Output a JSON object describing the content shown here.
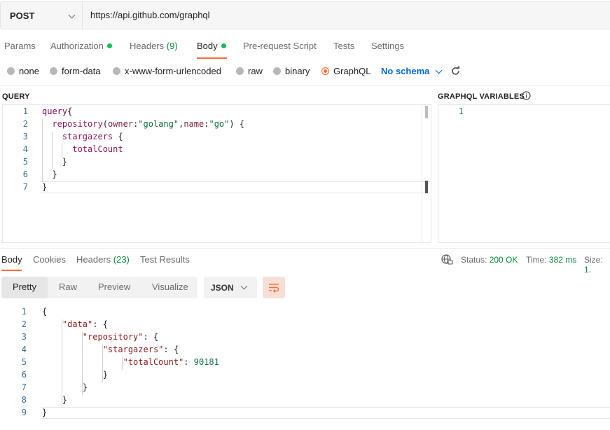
{
  "request": {
    "method": "POST",
    "url": "https://api.github.com/graphql"
  },
  "tabs": [
    {
      "label": "Params"
    },
    {
      "label": "Authorization"
    },
    {
      "label": "Headers",
      "count": "(9)"
    },
    {
      "label": "Body"
    },
    {
      "label": "Pre-request Script"
    },
    {
      "label": "Tests"
    },
    {
      "label": "Settings"
    }
  ],
  "body_modes": [
    {
      "label": "none"
    },
    {
      "label": "form-data"
    },
    {
      "label": "x-www-form-urlencoded"
    },
    {
      "label": "raw"
    },
    {
      "label": "binary"
    },
    {
      "label": "GraphQL",
      "selected": true
    }
  ],
  "schema": {
    "label": "No schema"
  },
  "query_title": "QUERY",
  "variables_title": "GRAPHQL VARIABLES",
  "query_lines": [
    {
      "n": "1",
      "text": "query{"
    },
    {
      "n": "2",
      "text": "  repository(owner:\"golang\",name:\"go\") {"
    },
    {
      "n": "3",
      "text": "    stargazers {"
    },
    {
      "n": "4",
      "text": "      totalCount"
    },
    {
      "n": "5",
      "text": "    }"
    },
    {
      "n": "6",
      "text": "  }"
    },
    {
      "n": "7",
      "text": "}"
    }
  ],
  "variables_lines": [
    {
      "n": "1",
      "text": ""
    }
  ],
  "response": {
    "tabs": [
      {
        "label": "Body"
      },
      {
        "label": "Cookies"
      },
      {
        "label": "Headers",
        "count": "(23)"
      },
      {
        "label": "Test Results"
      }
    ],
    "status_label": "Status:",
    "status_value": "200 OK",
    "time_label": "Time:",
    "time_value": "382 ms",
    "size_label": "Size:",
    "size_value": "1.",
    "formats": [
      "Pretty",
      "Raw",
      "Preview",
      "Visualize"
    ],
    "language": "JSON",
    "lines": [
      {
        "n": "1",
        "text": "{"
      },
      {
        "n": "2",
        "text": "    \"data\": {"
      },
      {
        "n": "3",
        "text": "        \"repository\": {"
      },
      {
        "n": "4",
        "text": "            \"stargazers\": {"
      },
      {
        "n": "5",
        "text": "                \"totalCount\": 90181"
      },
      {
        "n": "6",
        "text": "            }"
      },
      {
        "n": "7",
        "text": "        }"
      },
      {
        "n": "8",
        "text": "    }"
      },
      {
        "n": "9",
        "text": "}"
      }
    ]
  },
  "colors": {
    "accent": "#ff6c37",
    "link": "#0265d2",
    "ok": "#0cbb52"
  }
}
